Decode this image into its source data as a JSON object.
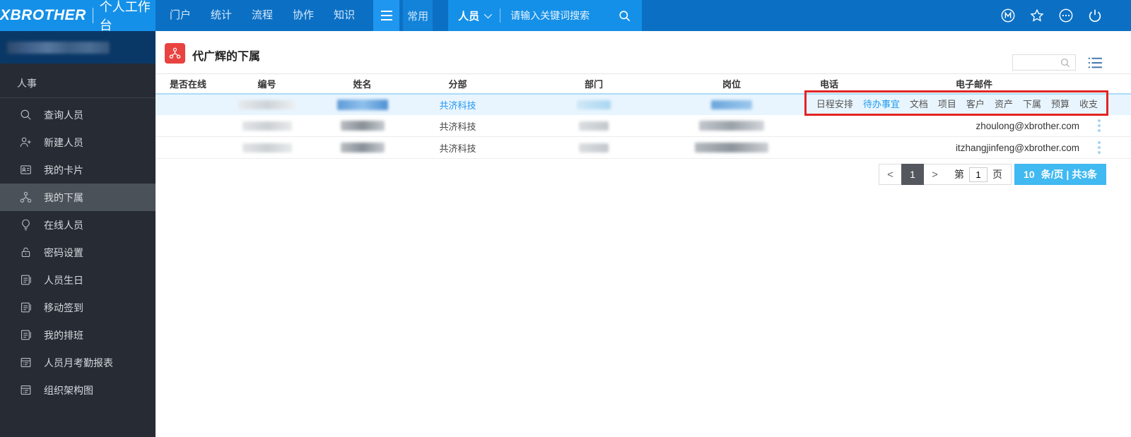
{
  "colors": {
    "topbar": "#0b70c4",
    "topbar_accent": "#1590e8",
    "sidebar": "#272c34",
    "sidebar_active": "#4b5158",
    "user_block_navy": "#0a3866",
    "link_blue": "#2196f3",
    "row_highlight": "#e9f5fe",
    "annotation_red": "#e32424",
    "title_icon_red": "#e84340",
    "pager_active_bg": "#54585e",
    "pager_info_bg": "#41b9f1"
  },
  "topbar": {
    "brand": "XBROTHER",
    "product": "个人工作台",
    "nav": [
      {
        "label": "门户"
      },
      {
        "label": "统计"
      },
      {
        "label": "流程"
      },
      {
        "label": "协作"
      },
      {
        "label": "知识"
      }
    ],
    "frequent": "常用",
    "search": {
      "category": "人员",
      "placeholder": "请输入关键词搜索"
    },
    "right_icons": [
      {
        "name": "m-badge-icon",
        "glyph": "M"
      },
      {
        "name": "star-icon"
      },
      {
        "name": "more-icon"
      },
      {
        "name": "power-icon"
      }
    ]
  },
  "sidebar": {
    "section": "人事",
    "items": [
      {
        "label": "查询人员",
        "icon": "search-icon"
      },
      {
        "label": "新建人员",
        "icon": "user-plus-icon"
      },
      {
        "label": "我的卡片",
        "icon": "id-card-icon"
      },
      {
        "label": "我的下属",
        "icon": "org-chart-icon",
        "active": true
      },
      {
        "label": "在线人员",
        "icon": "bulb-icon"
      },
      {
        "label": "密码设置",
        "icon": "lock-icon"
      },
      {
        "label": "人员生日",
        "icon": "document-icon"
      },
      {
        "label": "移动签到",
        "icon": "document-icon"
      },
      {
        "label": "我的排班",
        "icon": "document-icon"
      },
      {
        "label": "人员月考勤报表",
        "icon": "report-icon"
      },
      {
        "label": "组织架构图",
        "icon": "report-icon"
      }
    ]
  },
  "main": {
    "title": "代广辉的下属",
    "columns": [
      "是否在线",
      "编号",
      "姓名",
      "分部",
      "部门",
      "岗位",
      "电话",
      "电子邮件"
    ],
    "rows": {
      "r1": {
        "branch": "共济科技",
        "highlighted": true
      },
      "r2": {
        "branch": "共济科技",
        "email": "zhoulong@xbrother.com"
      },
      "r3": {
        "branch": "共济科技",
        "email": "itzhangjinfeng@xbrother.com"
      }
    },
    "actions": [
      {
        "label": "日程安排"
      },
      {
        "label": "待办事宜",
        "highlighted": true
      },
      {
        "label": "文档"
      },
      {
        "label": "项目"
      },
      {
        "label": "客户"
      },
      {
        "label": "资产"
      },
      {
        "label": "下属"
      },
      {
        "label": "预算"
      },
      {
        "label": "收支"
      }
    ],
    "pagination": {
      "prev": "<",
      "current_page": "1",
      "next": ">",
      "jump_prefix": "第",
      "jump_value": "1",
      "jump_suffix": "页",
      "page_size": "10",
      "size_info": "条/页 | 共3条"
    }
  }
}
